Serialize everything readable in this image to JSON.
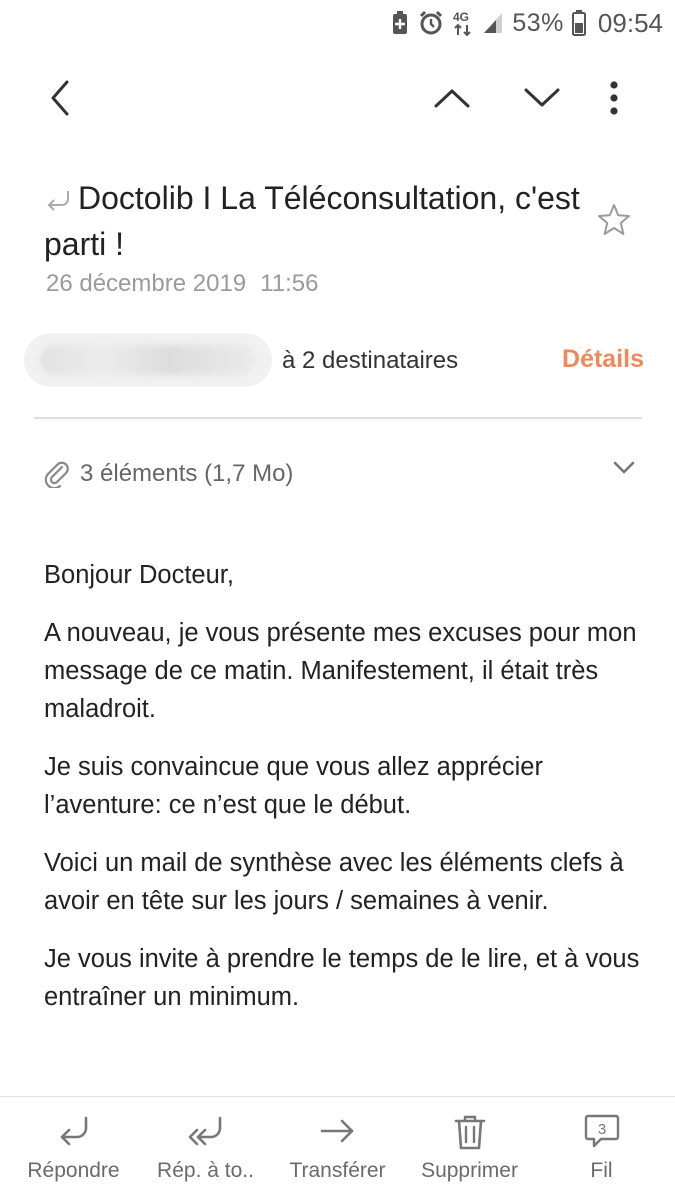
{
  "status_bar": {
    "network_label": "4G",
    "battery_percent": "53%",
    "time": "09:54"
  },
  "toolbar": {
    "back_icon": "chevron-left-icon",
    "prev_icon": "chevron-up-icon",
    "next_icon": "chevron-down-icon",
    "more_icon": "more-vertical-icon"
  },
  "email": {
    "subject": "Doctolib I La Téléconsultation, c'est parti !",
    "date": "26 décembre 2019",
    "time": "11:56",
    "recipients": "à 2 destinataires",
    "details_label": "Détails",
    "attachments_label": "3 éléments (1,7 Mo)",
    "body": [
      "Bonjour Docteur,",
      "A nouveau, je vous présente mes excuses pour mon message de ce matin. Manifestement, il était très maladroit.",
      "Je suis convaincue que vous allez apprécier l’aventure: ce n’est que le début.",
      "Voici un mail de synthèse avec les éléments clefs à avoir en tête sur les jours / semaines à venir.",
      "Je vous invite à prendre le temps de le lire, et à vous entraîner un minimum."
    ]
  },
  "bottom_bar": {
    "reply": "Répondre",
    "reply_all": "Rép. à to..",
    "forward": "Transférer",
    "delete": "Supprimer",
    "thread": "Fil",
    "thread_count": "3"
  },
  "colors": {
    "accent": "#f0895a",
    "muted_text": "#9a9a9a",
    "icon_gray": "#777777"
  }
}
